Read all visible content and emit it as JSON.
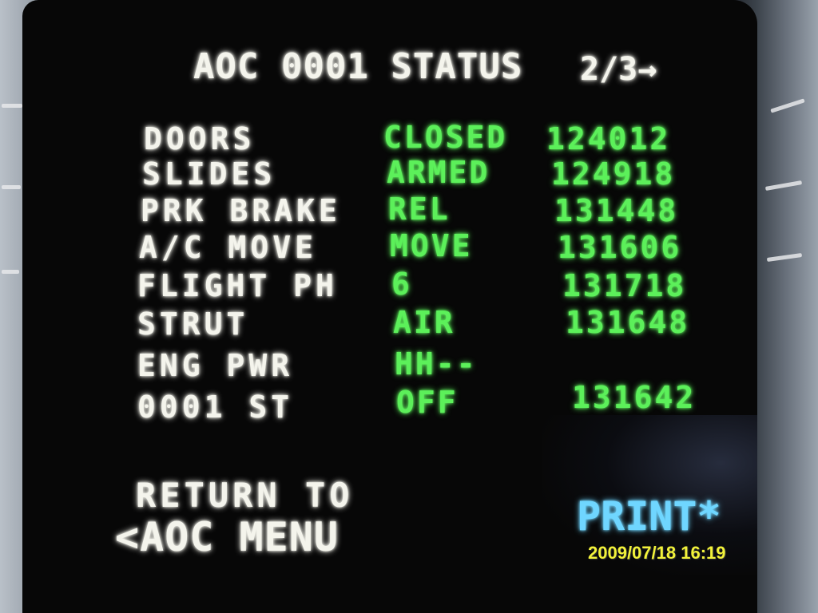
{
  "header": {
    "title": "AOC 0001 STATUS",
    "page": "2/3→"
  },
  "status_rows": [
    {
      "label": "DOORS",
      "value": "CLOSED",
      "time": "124012"
    },
    {
      "label": "SLIDES",
      "value": "ARMED",
      "time": "124918"
    },
    {
      "label": "PRK BRAKE",
      "value": "REL",
      "time": "131448"
    },
    {
      "label": "A/C MOVE",
      "value": "MOVE",
      "time": "131606"
    },
    {
      "label": "FLIGHT PH",
      "value": "6",
      "time": "131718"
    },
    {
      "label": "STRUT",
      "value": "AIR",
      "time": "131648"
    },
    {
      "label": "ENG PWR",
      "value": "HH--",
      "time": ""
    },
    {
      "label": "0001 ST",
      "value": "OFF",
      "time": "131642"
    }
  ],
  "left_key": {
    "line1": "RETURN TO",
    "line2": "<AOC MENU"
  },
  "right_key": {
    "label": "PRINT*"
  },
  "camera_timestamp": "2009/07/18 16:19",
  "colors": {
    "labels": "#f4f4ec",
    "values": "#5cf05a",
    "print_key": "#6fd6ff",
    "timestamp": "#f2f23a"
  }
}
